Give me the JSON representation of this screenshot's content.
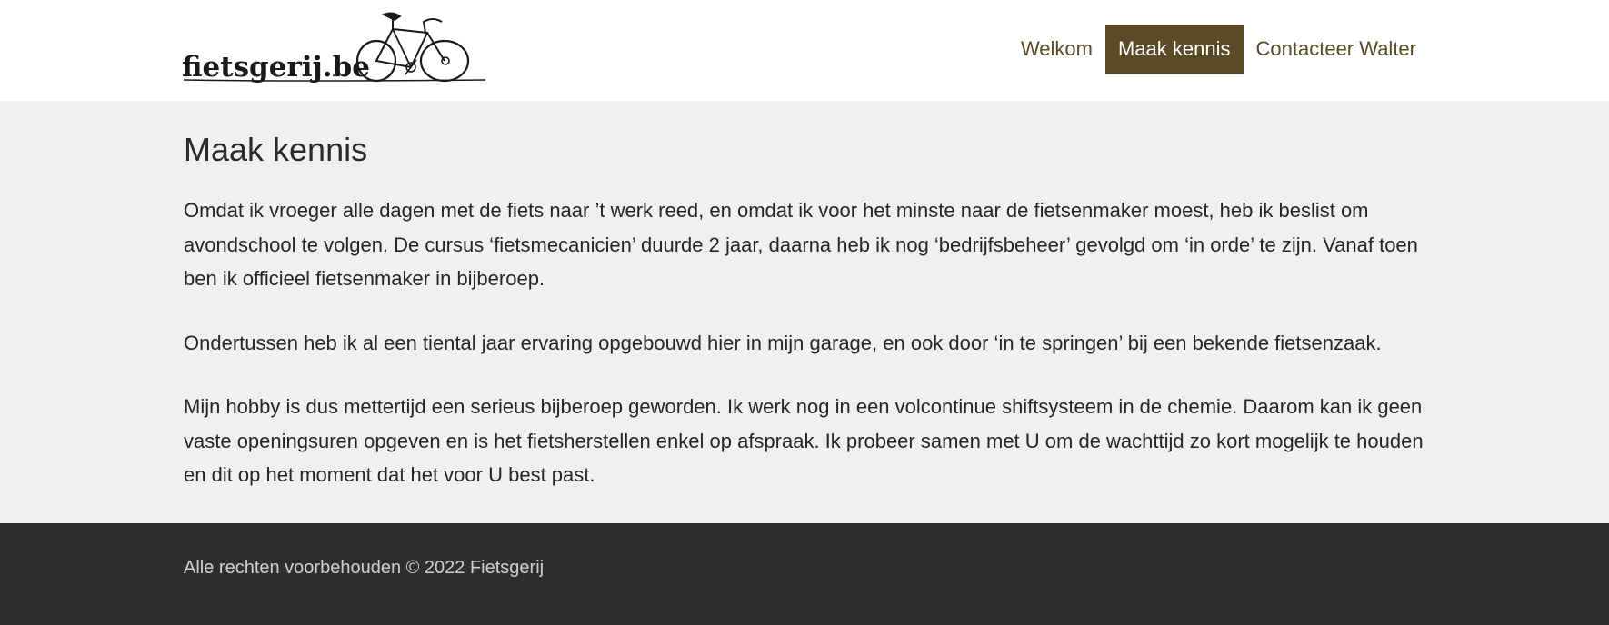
{
  "header": {
    "logo_text": "fietsgerij.be"
  },
  "nav": {
    "items": [
      {
        "label": "Welkom",
        "active": false
      },
      {
        "label": "Maak kennis",
        "active": true
      },
      {
        "label": "Contacteer Walter",
        "active": false
      }
    ]
  },
  "main": {
    "title": "Maak kennis",
    "paragraphs": [
      " Omdat ik vroeger alle dagen met de fiets naar ’t werk reed, en omdat ik voor het minste naar de fietsenmaker moest, heb ik beslist om avondschool te volgen. De cursus ‘fietsmecanicien’ duurde 2 jaar, daarna heb ik nog ‘bedrijfsbeheer’ gevolgd om ‘in orde’ te zijn. Vanaf toen ben ik officieel fietsenmaker in bijberoep.",
      "Ondertussen heb ik al een tiental jaar ervaring opgebouwd hier in mijn garage, en ook door ‘in te springen’ bij een bekende fietsenzaak.",
      "Mijn hobby is dus mettertijd een serieus bijberoep geworden.  Ik werk nog in een volcontinue shiftsysteem in de chemie. Daarom kan ik geen vaste openingsuren opgeven en is het fietsherstellen enkel op afspraak. Ik probeer samen met U om de wachttijd zo kort mogelijk te houden en dit op het moment dat het voor U best past."
    ]
  },
  "footer": {
    "copyright": "Alle rechten voorbehouden © 2022 Fietsgerij"
  },
  "colors": {
    "accent": "#5b4a26",
    "footer_bg": "#2e2e2e",
    "page_bg": "#f0f0f0"
  }
}
